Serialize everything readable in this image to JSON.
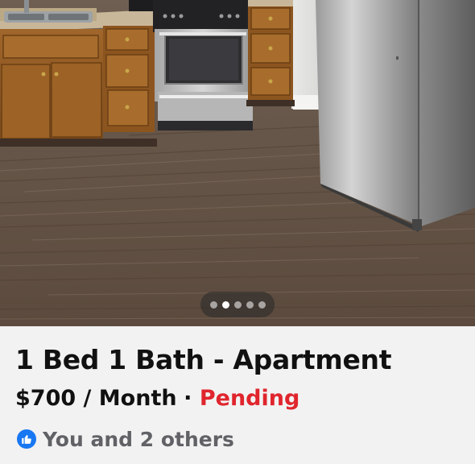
{
  "listing": {
    "title": "1 Bed 1 Bath - Apartment",
    "price": "$700 / Month",
    "separator": "·",
    "status": "Pending",
    "status_color": "#e0252d",
    "likes_text": "You and 2 others",
    "like_icon": "thumbs-up-icon"
  },
  "photo": {
    "description_icon": "listing-photo",
    "pager": {
      "count": 5,
      "active_index": 1
    }
  },
  "colors": {
    "accent": "#1877f2",
    "background": "#f2f2f2"
  }
}
